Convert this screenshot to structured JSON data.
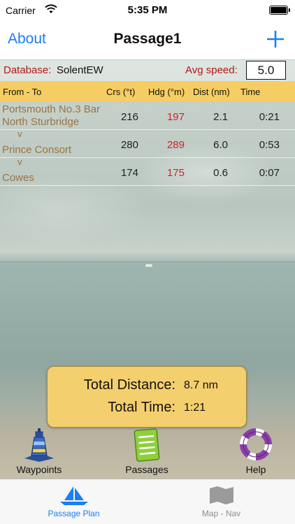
{
  "status_bar": {
    "carrier": "Carrier",
    "time": "5:35 PM"
  },
  "nav": {
    "left_button": "About",
    "title": "Passage1",
    "right_button_icon": "plus-icon"
  },
  "info": {
    "database_label": "Database:",
    "database_value": "SolentEW",
    "speed_label": "Avg speed:",
    "speed_value": "5.0"
  },
  "table": {
    "headers": {
      "from_to": "From - To",
      "crs": "Crs (°t)",
      "hdg": "Hdg (°m)",
      "dist": "Dist (nm)",
      "time": "Time"
    },
    "rows": [
      {
        "from": "Portsmouth No.3 Bar",
        "separator": "",
        "to": "North Sturbridge",
        "crs": "216",
        "hdg": "197",
        "dist": "2.1",
        "time": "0:21"
      },
      {
        "from": "",
        "separator": "v",
        "to": "Prince Consort",
        "crs": "280",
        "hdg": "289",
        "dist": "6.0",
        "time": "0:53"
      },
      {
        "from": "",
        "separator": "v",
        "to": "Cowes",
        "crs": "174",
        "hdg": "175",
        "dist": "0.6",
        "time": "0:07"
      }
    ]
  },
  "totals": {
    "distance_label": "Total Distance:",
    "distance_value": "8.7 nm",
    "time_label": "Total Time:",
    "time_value": "1:21"
  },
  "tools": {
    "waypoints": {
      "label": "Waypoints",
      "icon": "buoy-icon"
    },
    "passages": {
      "label": "Passages",
      "icon": "notepad-icon"
    },
    "help": {
      "label": "Help",
      "icon": "lifebuoy-icon"
    }
  },
  "tabs": [
    {
      "label": "Passage Plan",
      "icon": "sailboat-icon",
      "active": true
    },
    {
      "label": "Map - Nav",
      "icon": "map-icon",
      "active": false
    }
  ],
  "colors": {
    "accent": "#1a7ff2",
    "header_bg": "#f6cd62",
    "heading_red": "#d42020",
    "label_red": "#b01818",
    "waypoint_brown": "#9a7443",
    "tab_inactive": "#8e8e93"
  }
}
